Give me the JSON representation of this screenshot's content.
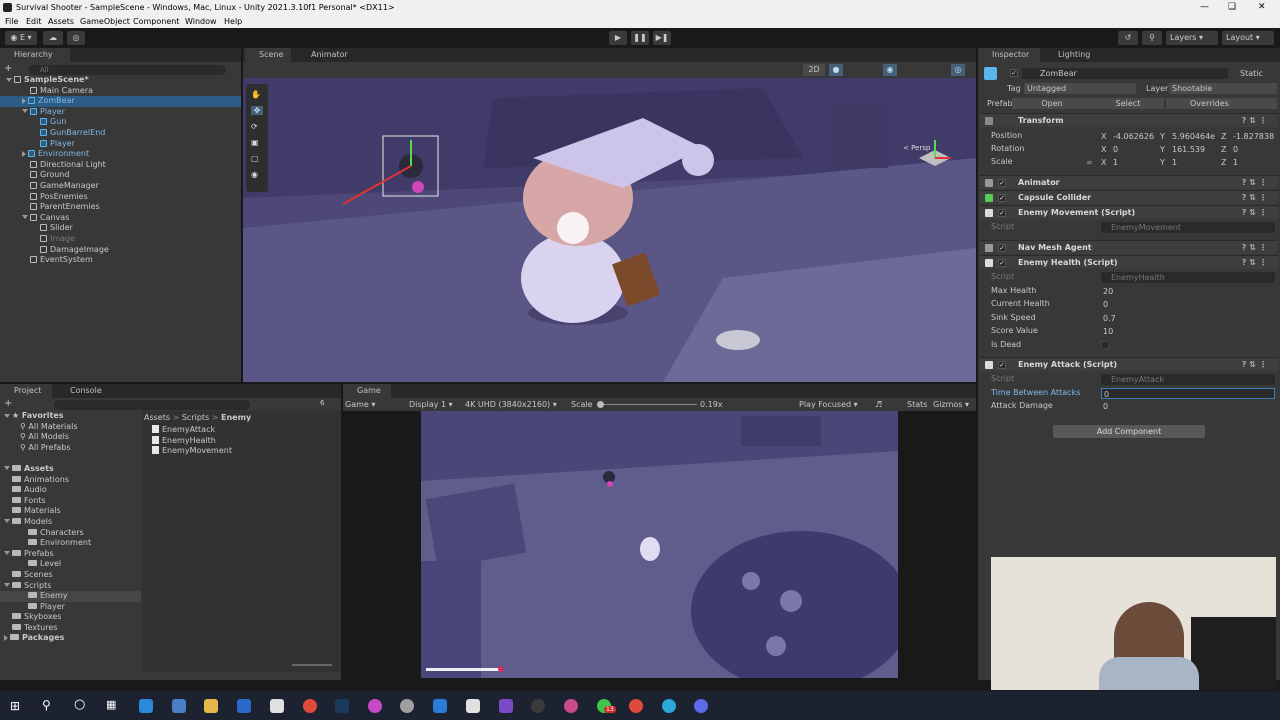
{
  "window": {
    "title": "Survival Shooter - SampleScene - Windows, Mac, Linux - Unity 2021.3.10f1 Personal* <DX11>"
  },
  "menu": [
    "File",
    "Edit",
    "Assets",
    "GameObject",
    "Component",
    "Window",
    "Help"
  ],
  "toolbar": {
    "account": "E",
    "layers": "Layers",
    "layout": "Layout"
  },
  "hierarchy": {
    "tab": "Hierarchy",
    "search_placeholder": "All",
    "items": [
      {
        "label": "SampleScene*",
        "depth": 0
      },
      {
        "label": "Main Camera",
        "depth": 1
      },
      {
        "label": "ZomBear",
        "depth": 1
      },
      {
        "label": "Player",
        "depth": 1
      },
      {
        "label": "Gun",
        "depth": 2
      },
      {
        "label": "GunBarrelEnd",
        "depth": 2
      },
      {
        "label": "Player",
        "depth": 2
      },
      {
        "label": "Environment",
        "depth": 1
      },
      {
        "label": "Directional Light",
        "depth": 1
      },
      {
        "label": "Ground",
        "depth": 1
      },
      {
        "label": "GameManager",
        "depth": 1
      },
      {
        "label": "PosEnemies",
        "depth": 1
      },
      {
        "label": "ParentEnemies",
        "depth": 1
      },
      {
        "label": "Canvas",
        "depth": 1
      },
      {
        "label": "Slider",
        "depth": 2
      },
      {
        "label": "Image",
        "depth": 2
      },
      {
        "label": "DamageImage",
        "depth": 2
      },
      {
        "label": "EventSystem",
        "depth": 1
      }
    ]
  },
  "scene": {
    "tabs": [
      "Scene",
      "Animator"
    ],
    "mode_2d": "2D",
    "persp": "< Persp"
  },
  "project": {
    "tabs": [
      "Project",
      "Console"
    ],
    "favorites_label": "Favorites",
    "favorites": [
      "All Materials",
      "All Models",
      "All Prefabs"
    ],
    "assets_label": "Assets",
    "assets": [
      {
        "label": "Animations",
        "depth": 1
      },
      {
        "label": "Audio",
        "depth": 1
      },
      {
        "label": "Fonts",
        "depth": 1
      },
      {
        "label": "Materials",
        "depth": 1
      },
      {
        "label": "Models",
        "depth": 1
      },
      {
        "label": "Characters",
        "depth": 2
      },
      {
        "label": "Environment",
        "depth": 2
      },
      {
        "label": "Prefabs",
        "depth": 1
      },
      {
        "label": "Level",
        "depth": 2
      },
      {
        "label": "Scenes",
        "depth": 1
      },
      {
        "label": "Scripts",
        "depth": 1
      },
      {
        "label": "Enemy",
        "depth": 2
      },
      {
        "label": "Player",
        "depth": 2
      },
      {
        "label": "Skyboxes",
        "depth": 1
      },
      {
        "label": "Textures",
        "depth": 1
      }
    ],
    "packages_label": "Packages",
    "breadcrumb": [
      "Assets",
      "Scripts",
      "Enemy"
    ],
    "files": [
      "EnemyAttack",
      "EnemyHealth",
      "EnemyMovement"
    ],
    "hidden_count": "6"
  },
  "game": {
    "tab": "Game",
    "mode": "Game",
    "display": "Display 1",
    "resolution": "4K UHD (3840x2160)",
    "scale_label": "Scale",
    "scale_value": "0.19x",
    "play_mode": "Play Focused",
    "stats": "Stats",
    "gizmos": "Gizmos"
  },
  "inspector": {
    "tabs": [
      "Inspector",
      "Lighting"
    ],
    "object_name": "ZomBear",
    "static_label": "Static",
    "tag_label": "Tag",
    "tag_value": "Untagged",
    "layer_label": "Layer",
    "layer_value": "Shootable",
    "prefab_label": "Prefab",
    "prefab_open": "Open",
    "prefab_select": "Select",
    "prefab_overrides": "Overrides",
    "transform": {
      "title": "Transform",
      "position_label": "Position",
      "rotation_label": "Rotation",
      "scale_label": "Scale",
      "pos": [
        "-4.062626",
        "5.960464e",
        "-1.827838"
      ],
      "rot": [
        "0",
        "161.539",
        "0"
      ],
      "scl": [
        "1",
        "1",
        "1"
      ]
    },
    "components": [
      "Animator",
      "Capsule Collider",
      "Enemy Movement (Script)",
      "Nav Mesh Agent",
      "Enemy Health (Script)",
      "Enemy Attack (Script)"
    ],
    "script_label": "Script",
    "movement_script": "EnemyMovement",
    "health_script": "EnemyHealth",
    "attack_script": "EnemyAttack",
    "health_fields": [
      {
        "label": "Max Health",
        "value": "20"
      },
      {
        "label": "Current Health",
        "value": "0"
      },
      {
        "label": "Sink Speed",
        "value": "0.7"
      },
      {
        "label": "Score Value",
        "value": "10"
      },
      {
        "label": "Is Dead",
        "value": ""
      }
    ],
    "attack_fields": [
      {
        "label": "Time Between Attacks",
        "value": "0"
      },
      {
        "label": "Attack Damage",
        "value": "0"
      }
    ],
    "add_component": "Add Component"
  },
  "taskbar": {
    "badge": "13"
  }
}
